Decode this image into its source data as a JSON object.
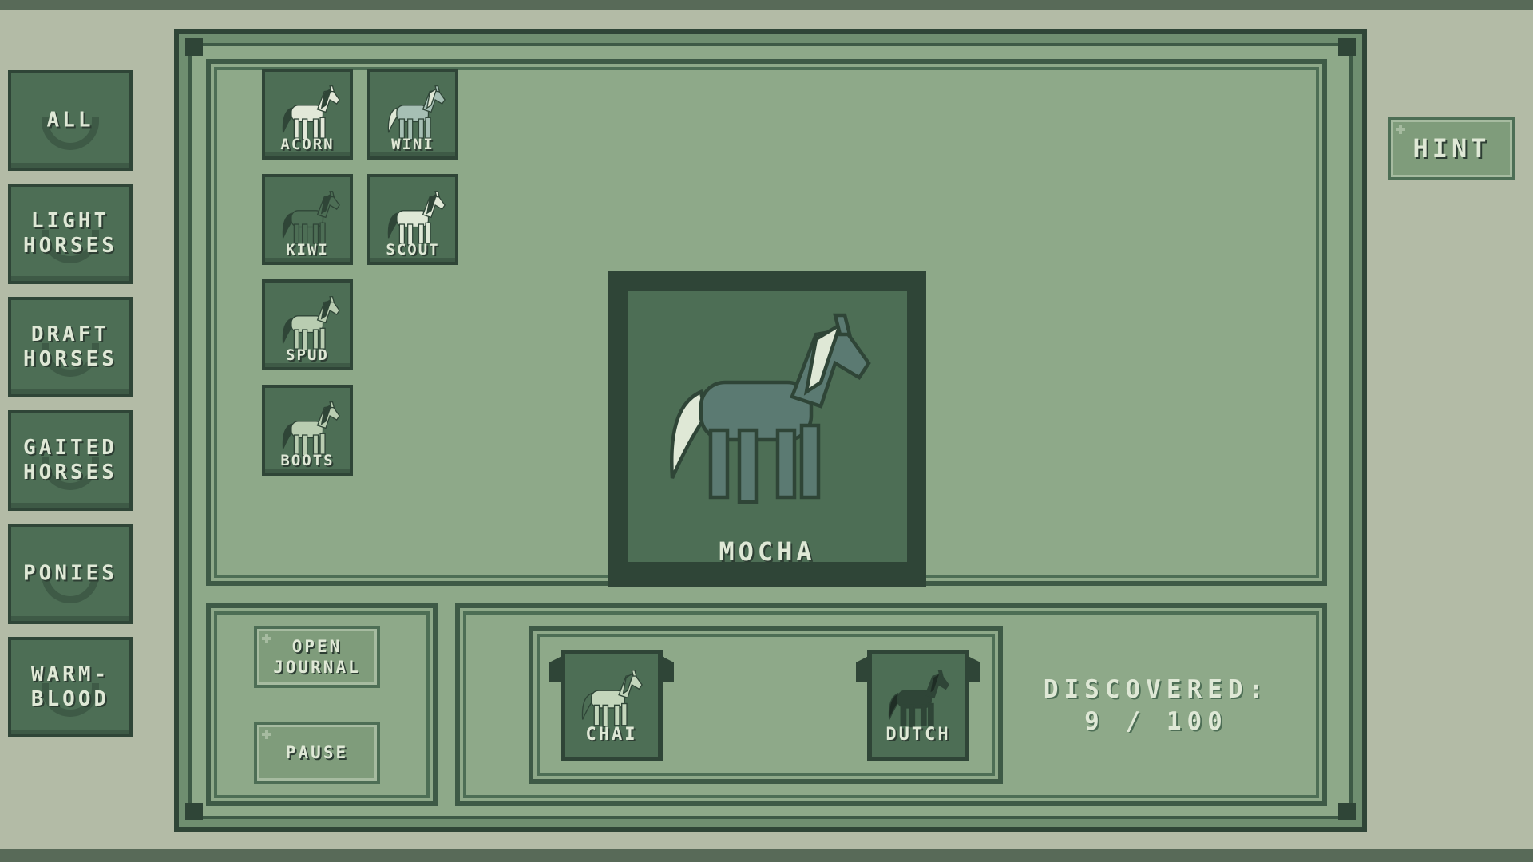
{
  "categories": [
    {
      "label": "ALL"
    },
    {
      "label": "LIGHT\nHORSES"
    },
    {
      "label": "DRAFT\nHORSES"
    },
    {
      "label": "GAITED\nHORSES"
    },
    {
      "label": "PONIES"
    },
    {
      "label": "WARM-\nBLOOD"
    }
  ],
  "hint_button": {
    "label": "HINT"
  },
  "collection": [
    {
      "name": "ACORN",
      "coat": "#e2e8d8",
      "mane": "#2f4537"
    },
    {
      "name": "WINI",
      "coat": "#a6bfb4",
      "mane": "#dfe8d6"
    },
    {
      "name": "KIWI",
      "coat": "#4d6e55",
      "mane": "#2f4537"
    },
    {
      "name": "SCOUT",
      "coat": "#dfe8d6",
      "mane": "#2f4537"
    },
    {
      "name": "SPUD",
      "coat": "#b9cdb1",
      "mane": "#2f4537"
    },
    {
      "name": "BOOTS",
      "coat": "#b9cdb1",
      "mane": "#2f4537"
    }
  ],
  "featured": {
    "name": "MOCHA",
    "coat": "#5b7a72",
    "mane": "#dfe8d6"
  },
  "controls": {
    "journal_label": "OPEN\nJOURNAL",
    "pause_label": "PAUSE"
  },
  "breeding": [
    {
      "name": "CHAI",
      "coat": "#c4d6bc",
      "mane": "#4d6e55"
    },
    {
      "name": "DUTCH",
      "coat": "#2f4537",
      "mane": "#1f2d25"
    }
  ],
  "discovered": {
    "label": "DISCOVERED:",
    "count": "9 / 100"
  },
  "colors": {
    "dark": "#2f4537",
    "mid": "#4d6e55",
    "light": "#8ea989",
    "bg": "#b3bba6"
  },
  "icons": [
    "horseshoe-icon",
    "plus-icon",
    "horse-icon",
    "stall-icon"
  ]
}
